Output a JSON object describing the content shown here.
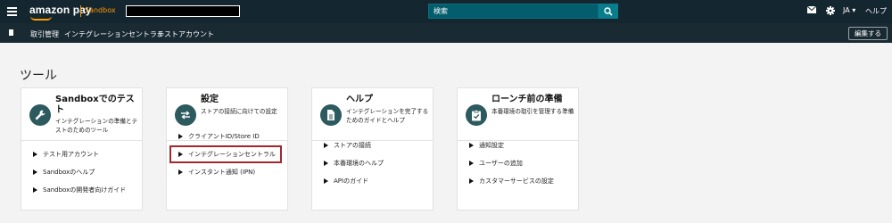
{
  "header": {
    "logo_text": "amazon pay",
    "sandbox_label": "Sandbox",
    "search_placeholder": "検索",
    "language": "JA ▾",
    "help": "ヘルプ"
  },
  "nav": {
    "items": [
      "取引管理",
      "インテグレーションセントラル",
      "テストアカウント"
    ],
    "edit_button": "編集する"
  },
  "page_title": "ツール",
  "cards": [
    {
      "title": "Sandboxでのテスト",
      "desc": "インテグレーションの準備とテストのためのツール",
      "icon": "wrench-icon",
      "links": [
        "テスト用アカウント",
        "Sandboxのヘルプ",
        "Sandboxの開発者向けガイド"
      ]
    },
    {
      "title": "設定",
      "desc": "ストアの接続に向けての設定",
      "icon": "arrows-icon",
      "links": [
        "クライアントID/Store ID",
        "インテグレーションセントラル",
        "インスタント通知 (IPN)"
      ]
    },
    {
      "title": "ヘルプ",
      "desc": "インテグレーションを完了するためのガイドとヘルプ",
      "icon": "document-icon",
      "links": [
        "ストアの接続",
        "本番環境のヘルプ",
        "APIのガイド"
      ]
    },
    {
      "title": "ローンチ前の準備",
      "desc": "本番環境の取引を管理する準備",
      "icon": "checklist-icon",
      "links": [
        "通知設定",
        "ユーザーの追加",
        "カスタマーサービスの設定"
      ]
    }
  ],
  "colors": {
    "topbar_bg": "#14262f",
    "navbar_bg": "#192a33",
    "accent_orange": "#ff9900",
    "search_bg": "#045d6c",
    "icon_circle": "#2c5a5f",
    "highlight_border": "#a0282d"
  }
}
